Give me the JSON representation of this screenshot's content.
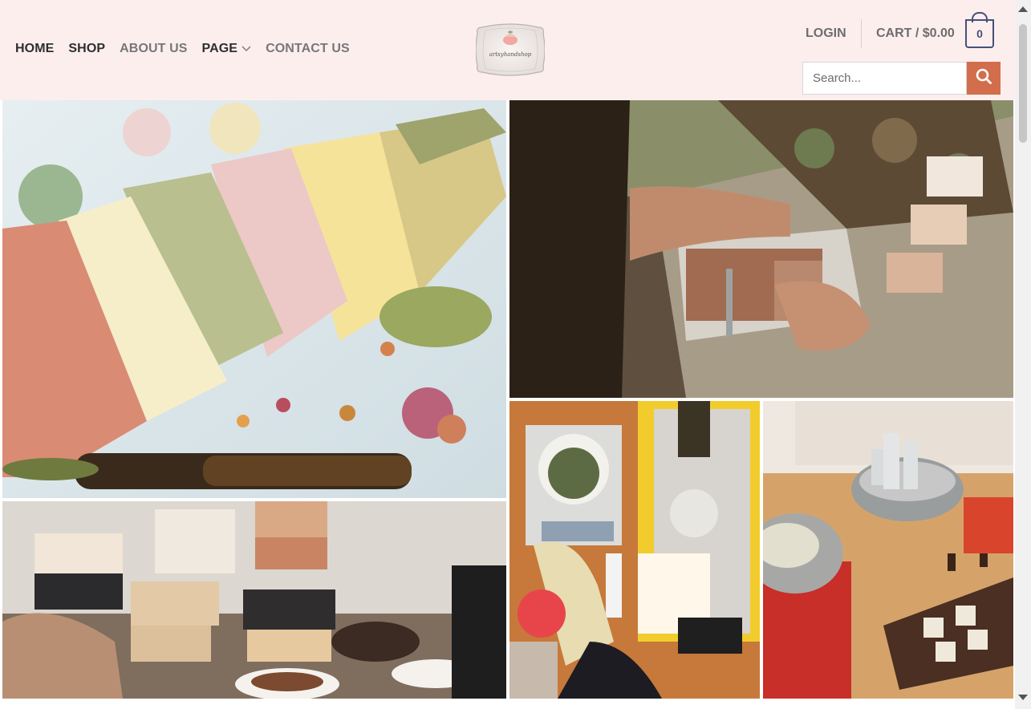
{
  "nav": {
    "items": [
      {
        "label": "HOME",
        "active": true
      },
      {
        "label": "SHOP",
        "active": true
      },
      {
        "label": "ABOUT US",
        "active": false
      },
      {
        "label": "PAGE",
        "active": true,
        "has_dropdown": true
      },
      {
        "label": "CONTACT US",
        "active": false
      }
    ]
  },
  "logo": {
    "text": "artsyhandshop"
  },
  "header_right": {
    "login_label": "LOGIN",
    "cart_label": "CART / $0.00",
    "cart_count": "0",
    "search_placeholder": "Search..."
  },
  "colors": {
    "header_bg": "#fdeeee",
    "accent": "#d26e4b",
    "cart_border": "#44507a"
  },
  "gallery": [
    {
      "id": "colorful-soap-bars",
      "subject": "pastel handmade soap bars with dried flowers"
    },
    {
      "id": "cutting-soap-loaf",
      "subject": "hands cutting a soap loaf with a crinkle cutter"
    },
    {
      "id": "soap-stacks",
      "subject": "stacks of handmade soap bars with spices"
    },
    {
      "id": "weighing-ingredients",
      "subject": "weighing soap making ingredients on a scale"
    },
    {
      "id": "melting-soap-base",
      "subject": "melting soap base on a hot plate with molds"
    }
  ]
}
